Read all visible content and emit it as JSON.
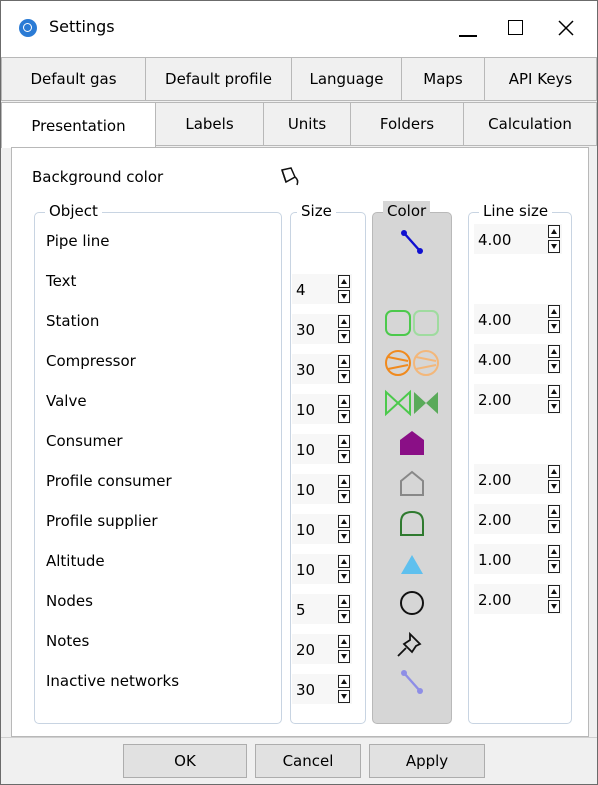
{
  "window": {
    "title": "Settings"
  },
  "tabs_row1": [
    {
      "label": "Default gas"
    },
    {
      "label": "Default profile"
    },
    {
      "label": "Language"
    },
    {
      "label": "Maps"
    },
    {
      "label": "API Keys"
    }
  ],
  "tabs_row2": [
    {
      "label": "Presentation",
      "active": true
    },
    {
      "label": "Labels"
    },
    {
      "label": "Units"
    },
    {
      "label": "Folders"
    },
    {
      "label": "Calculation"
    }
  ],
  "background": {
    "label": "Background color",
    "icon": "paint-bucket-icon"
  },
  "headers": {
    "object": "Object",
    "size": "Size",
    "color": "Color",
    "line_size": "Line size"
  },
  "rows": [
    {
      "label": "Pipe line",
      "size": "",
      "line_size": "4.00",
      "icon": "pipe-line-icon",
      "color": "#1010d0"
    },
    {
      "label": "Text",
      "size": "4",
      "line_size": "",
      "icon": "",
      "color": ""
    },
    {
      "label": "Station",
      "size": "30",
      "line_size": "4.00",
      "icon": "station-icon",
      "color": "#4cc94c"
    },
    {
      "label": "Compressor",
      "size": "30",
      "line_size": "4.00",
      "icon": "compressor-icon",
      "color": "#f08a1e"
    },
    {
      "label": "Valve",
      "size": "10",
      "line_size": "2.00",
      "icon": "valve-icon",
      "color": "#4cc94c"
    },
    {
      "label": "Consumer",
      "size": "10",
      "line_size": "",
      "icon": "consumer-icon",
      "color": "#8a0f86"
    },
    {
      "label": "Profile consumer",
      "size": "10",
      "line_size": "2.00",
      "icon": "profile-consumer-icon",
      "color": "#888888"
    },
    {
      "label": "Profile supplier",
      "size": "10",
      "line_size": "2.00",
      "icon": "profile-supplier-icon",
      "color": "#2f7a2f"
    },
    {
      "label": "Altitude",
      "size": "10",
      "line_size": "1.00",
      "icon": "altitude-icon",
      "color": "#5fc0ee"
    },
    {
      "label": "Nodes",
      "size": "5",
      "line_size": "2.00",
      "icon": "node-icon",
      "color": "#111111"
    },
    {
      "label": "Notes",
      "size": "20",
      "line_size": "",
      "icon": "pin-icon",
      "color": "#111111"
    },
    {
      "label": "Inactive networks",
      "size": "30",
      "line_size": "",
      "icon": "inactive-line-icon",
      "color": "#8e8ee6"
    }
  ],
  "buttons": {
    "ok": "OK",
    "cancel": "Cancel",
    "apply": "Apply"
  }
}
